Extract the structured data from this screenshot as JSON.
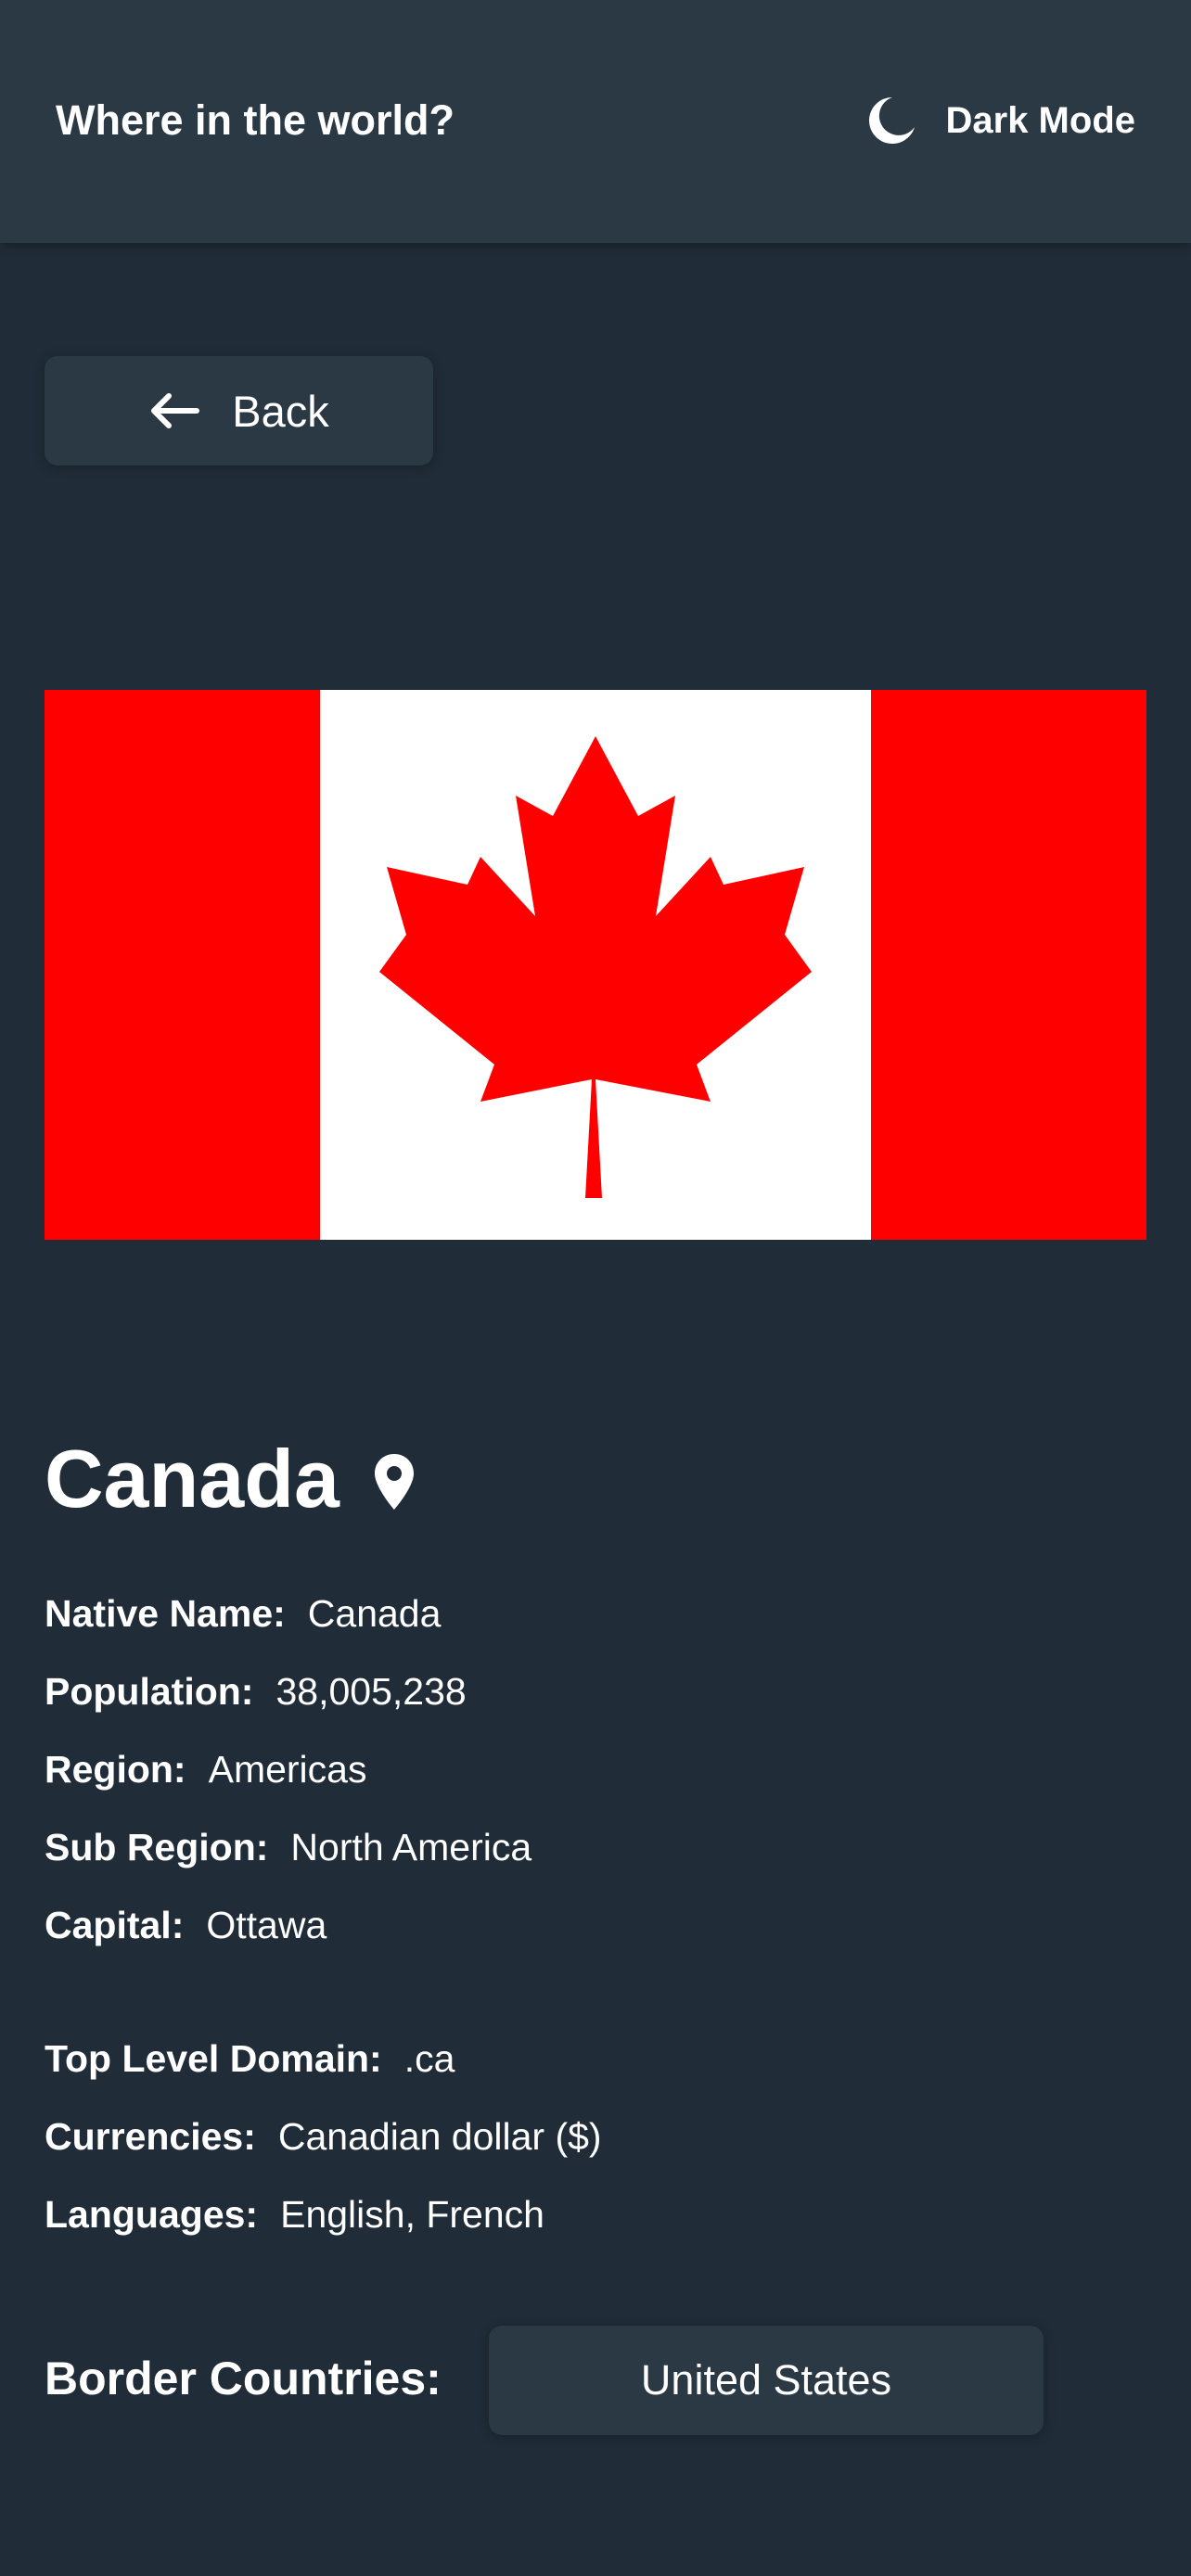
{
  "header": {
    "title": "Where in the world?",
    "theme_toggle_label": "Dark Mode",
    "theme_icon": "moon-icon"
  },
  "back_button": {
    "label": "Back",
    "icon": "arrow-left-icon"
  },
  "country": {
    "name": "Canada",
    "flag_icon": "canada-flag",
    "location_icon": "map-pin-icon",
    "details": [
      {
        "label": "Native Name:",
        "value": "Canada"
      },
      {
        "label": "Population:",
        "value": "38,005,238"
      },
      {
        "label": "Region:",
        "value": "Americas"
      },
      {
        "label": "Sub Region:",
        "value": "North America"
      },
      {
        "label": "Capital:",
        "value": "Ottawa"
      }
    ],
    "extra_details": [
      {
        "label": "Top Level Domain:",
        "value": ".ca"
      },
      {
        "label": "Currencies:",
        "value": "Canadian dollar ($)"
      },
      {
        "label": "Languages:",
        "value": "English, French"
      }
    ],
    "border_label": "Border Countries:",
    "borders": [
      "United States"
    ]
  },
  "colors": {
    "background": "#202c37",
    "element": "#2b3945",
    "text": "#ffffff",
    "flag_red": "#ff0000",
    "flag_white": "#ffffff"
  }
}
